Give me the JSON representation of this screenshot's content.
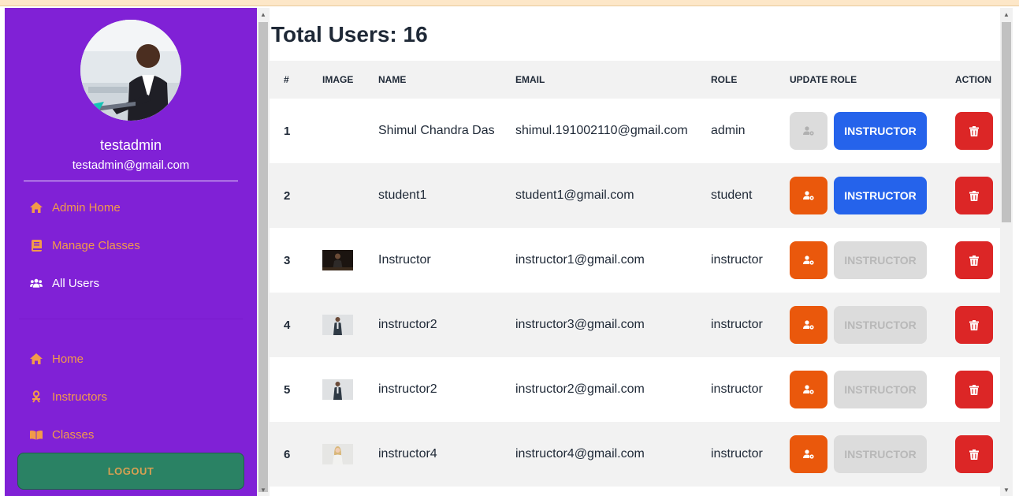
{
  "sidebar": {
    "user_name": "testadmin",
    "user_email": "testadmin@gmail.com",
    "admin_nav": [
      {
        "label": "Admin Home",
        "icon": "home-icon",
        "active": false
      },
      {
        "label": "Manage Classes",
        "icon": "book-icon",
        "active": false
      },
      {
        "label": "All Users",
        "icon": "users-icon",
        "active": true
      }
    ],
    "main_nav": [
      {
        "label": "Home",
        "icon": "home-icon"
      },
      {
        "label": "Instructors",
        "icon": "instructor-icon"
      },
      {
        "label": "Classes",
        "icon": "open-book-icon"
      }
    ],
    "logout_label": "LOGOUT"
  },
  "main": {
    "title": "Total Users: 16",
    "columns": [
      "#",
      "IMAGE",
      "NAME",
      "EMAIL",
      "ROLE",
      "UPDATE ROLE",
      "ACTION"
    ],
    "rows": [
      {
        "num": "1",
        "name": "Shimul Chandra Das",
        "email": "shimul.191002110@gmail.com",
        "role": "admin",
        "image": "none",
        "role_button_enabled": false,
        "instructor_button_enabled": true
      },
      {
        "num": "2",
        "name": "student1",
        "email": "student1@gmail.com",
        "role": "student",
        "image": "none",
        "role_button_enabled": true,
        "instructor_button_enabled": true
      },
      {
        "num": "3",
        "name": "Instructor",
        "email": "instructor1@gmail.com",
        "role": "instructor",
        "image": "dark-photo",
        "role_button_enabled": true,
        "instructor_button_enabled": false
      },
      {
        "num": "4",
        "name": "instructor2",
        "email": "instructor3@gmail.com",
        "role": "instructor",
        "image": "man-photo",
        "role_button_enabled": true,
        "instructor_button_enabled": false
      },
      {
        "num": "5",
        "name": "instructor2",
        "email": "instructor2@gmail.com",
        "role": "instructor",
        "image": "man-photo",
        "role_button_enabled": true,
        "instructor_button_enabled": false
      },
      {
        "num": "6",
        "name": "instructor4",
        "email": "instructor4@gmail.com",
        "role": "instructor",
        "image": "woman-photo",
        "role_button_enabled": true,
        "instructor_button_enabled": false
      }
    ],
    "instructor_button_label": "INSTRUCTOR"
  },
  "colors": {
    "sidebar_bg": "#8021d6",
    "nav_text": "#f29a4a",
    "logout_bg": "#2a8264",
    "role_button": "#ea580c",
    "instructor_button": "#2563eb",
    "delete_button": "#dc2626"
  }
}
